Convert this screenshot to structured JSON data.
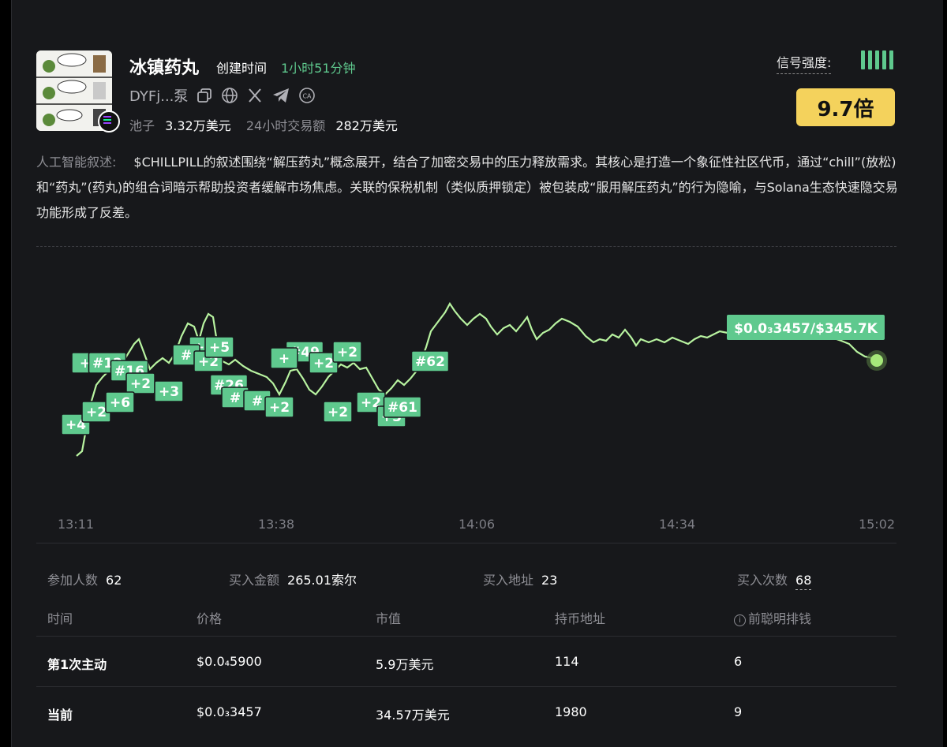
{
  "token": {
    "name": "冰镇药丸",
    "created_label": "创建时间",
    "created_value": "1小时51分钟",
    "address": "DYFj...泵",
    "pool_label": "池子",
    "pool_value": "3.32万美元",
    "volume_label": "24小时交易额",
    "volume_value": "282万美元"
  },
  "signal": {
    "label": "信号强度:",
    "multiplier": "9.7倍",
    "bars": 5
  },
  "narrative": {
    "label": "人工智能叙述:",
    "text": "$CHILLPILL的叙述围绕“解压药丸”概念展开，结合了加密交易中的压力释放需求。其核心是打造一个象征性社区代币，通过“chill”(放松)和“药丸”(药丸)的组合词暗示帮助投资者缓解市场焦虑。关联的保税机制（类似质押锁定）被包装成“服用解压药丸”的行为隐喻，与Solana生态快速隐交易功能形成了反差。"
  },
  "chart": {
    "current_label": "$0.0₃3457/$345.7K",
    "x_ticks": [
      "13:11",
      "13:38",
      "14:06",
      "14:34",
      "15:02"
    ],
    "markers": [
      "+4",
      "+2",
      "+",
      "#12",
      "#16",
      "+2",
      "+6",
      "+5",
      "+3",
      "#",
      "+2",
      "+5",
      "#26",
      "#",
      "#",
      "+2",
      "#49",
      "+",
      "+2",
      "+2",
      "+2",
      "+2",
      "+3",
      "#61",
      "#62"
    ],
    "colors": {
      "line": "#b8f3a0",
      "marker": "#5fc98e",
      "dot": "#a6e87a"
    }
  },
  "summary": [
    {
      "label": "参加人数",
      "value": "62"
    },
    {
      "label": "买入金额",
      "value": "265.01索尔"
    },
    {
      "label": "买入地址",
      "value": "23"
    },
    {
      "label": "买入次数",
      "value": "68"
    }
  ],
  "table": {
    "headers": [
      "时间",
      "价格",
      "市值",
      "持币地址",
      "前聪明排钱"
    ],
    "rows": [
      {
        "time": "第1次主动",
        "price": "$0.0₄5900",
        "mcap": "5.9万美元",
        "holders": "114",
        "rank": "6"
      },
      {
        "time": "当前",
        "price": "$0.0₃3457",
        "mcap": "34.57万美元",
        "holders": "1980",
        "rank": "9"
      }
    ]
  }
}
